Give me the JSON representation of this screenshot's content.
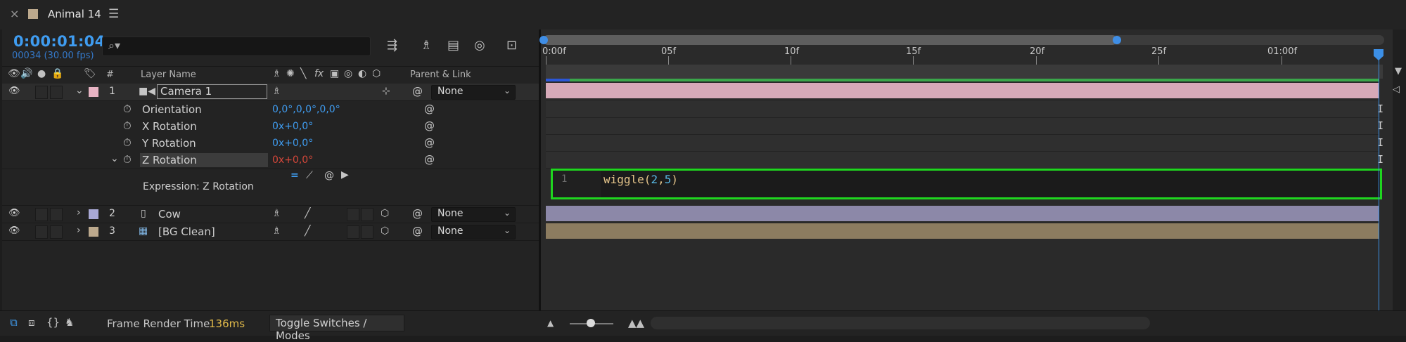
{
  "comp": {
    "tab_title": "Animal 14",
    "timecode": "0:00:01:04",
    "frames_fps": "00034 (30.00 fps)",
    "swatch_color": "#bca98d"
  },
  "search": {
    "placeholder": ""
  },
  "header": {
    "hash": "#",
    "layer_name": "Layer Name",
    "parent_link": "Parent & Link",
    "switch_icons": [
      "shy-icon",
      "collapse-icon",
      "quality-icon",
      "fx-icon",
      "frame-blend-icon",
      "motion-blur-icon",
      "adjustment-icon",
      "3d-icon"
    ]
  },
  "layers": [
    {
      "index": "1",
      "name": "Camera 1",
      "color": "#e8b4c4",
      "parent": "None",
      "properties": [
        {
          "name": "Orientation",
          "value": "0,0°,0,0°,0,0°",
          "red": false
        },
        {
          "name": "X Rotation",
          "value": "0x+0,0°",
          "red": false
        },
        {
          "name": "Y Rotation",
          "value": "0x+0,0°",
          "red": false
        },
        {
          "name": "Z Rotation",
          "value": "0x+0,0°",
          "red": true
        }
      ],
      "expression_label": "Expression: Z Rotation"
    },
    {
      "index": "2",
      "name": "Cow",
      "color": "#a9a9d6",
      "parent": "None"
    },
    {
      "index": "3",
      "name": "[BG Clean]",
      "color": "#bca98d",
      "parent": "None"
    }
  ],
  "ruler": {
    "ticks": [
      "0:00f",
      "05f",
      "10f",
      "15f",
      "20f",
      "25f",
      "01:00f"
    ]
  },
  "expression": {
    "line_number": "1",
    "fn": "wiggle(",
    "arg1": "2",
    "comma": ",",
    "arg2": "5",
    "close": ")"
  },
  "bottom": {
    "frame_render_label": "Frame Render Time",
    "frame_render_value": "136ms",
    "toggle_label": "Toggle Switches / Modes"
  }
}
